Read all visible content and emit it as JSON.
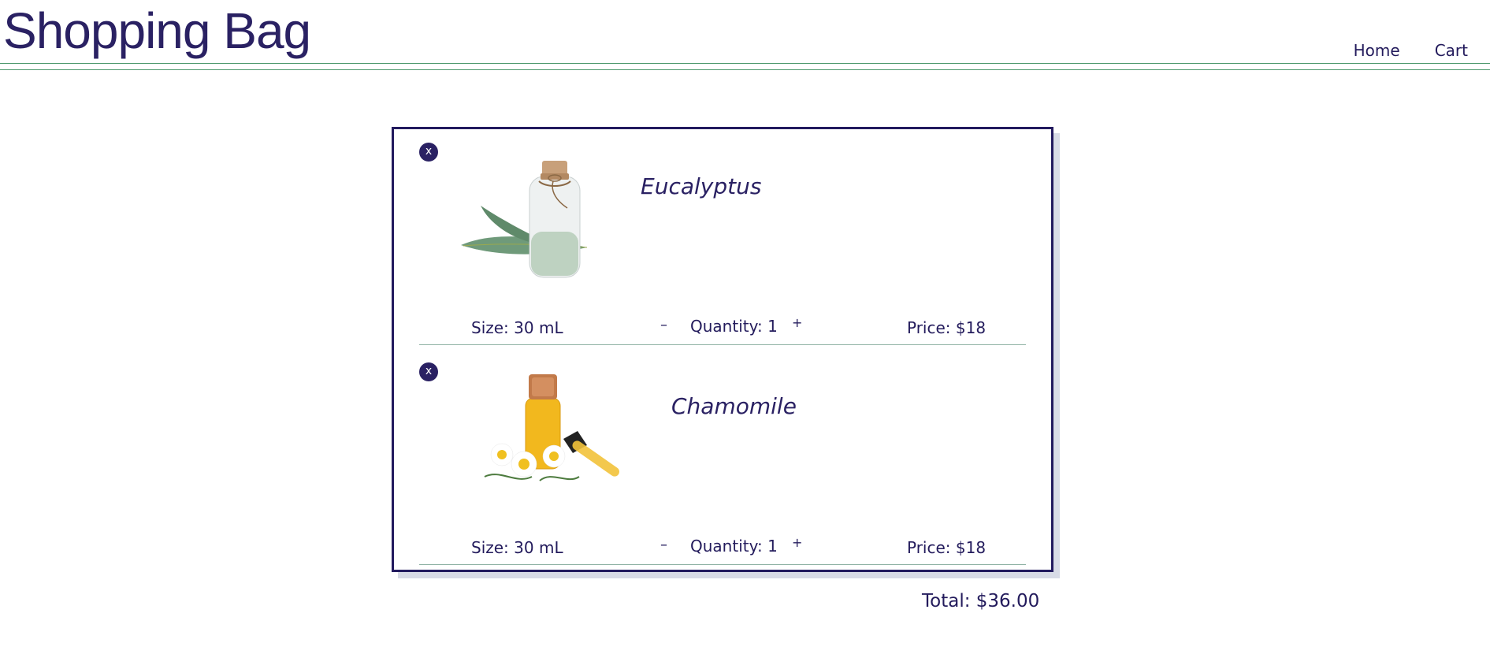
{
  "page": {
    "title": "Shopping Bag"
  },
  "nav": {
    "home": "Home",
    "cart": "Cart"
  },
  "bag": {
    "remove_label": "x",
    "minus_label": "–",
    "plus_label": "+",
    "items": [
      {
        "name": "Eucalyptus",
        "image": "eucalyptus-oil-bottle-icon",
        "size": "Size: 30 mL",
        "quantity": "Quantity: 1",
        "price": "Price: $18"
      },
      {
        "name": "Chamomile",
        "image": "chamomile-oil-bottle-icon",
        "size": "Size: 30 mL",
        "quantity": "Quantity: 1",
        "price": "Price: $18"
      }
    ],
    "total": "Total: $36.00"
  },
  "colors": {
    "primary": "#2a2163",
    "rule": "#4f9a6e",
    "shadow": "#d8dbe6"
  }
}
